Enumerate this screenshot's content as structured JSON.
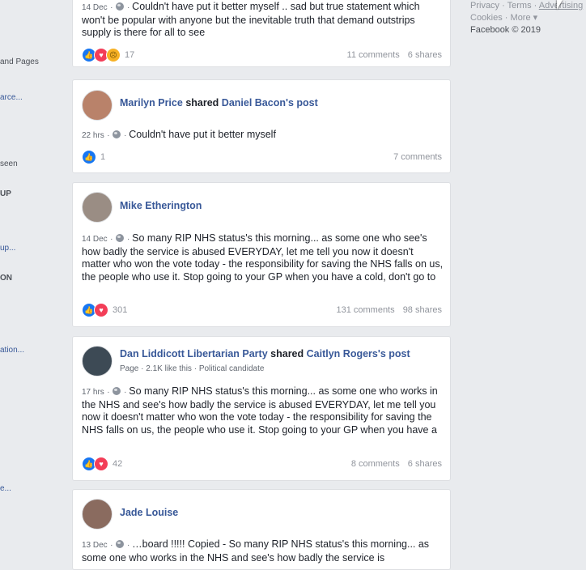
{
  "sidebar": {
    "items": [
      {
        "label": "and Pages",
        "style": "plain"
      },
      {
        "label": "arce...",
        "style": "link"
      },
      {
        "label": "seen",
        "style": "plain"
      },
      {
        "label": "UP",
        "style": "bold"
      },
      {
        "label": "up...",
        "style": "link"
      },
      {
        "label": "ON",
        "style": "bold"
      },
      {
        "label": "ation...",
        "style": "link"
      },
      {
        "label": "e...",
        "style": "link"
      }
    ]
  },
  "footer": {
    "privacy": "Privacy",
    "terms": "Terms",
    "advertising": "Advertising",
    "cookies": "Cookies",
    "more": "More",
    "copyright": "Facebook © 2019"
  },
  "posts": [
    {
      "time": "14 Dec",
      "text": "Couldn't have put it better myself .. sad but true statement which won't be popular with anyone but the inevitable truth that demand outstrips supply is there for all to see",
      "reactions_count": "17",
      "comments": "11 comments",
      "shares": "6 shares"
    },
    {
      "author": "Marilyn Price",
      "verb": "shared",
      "target": "Daniel Bacon's post",
      "time": "22 hrs",
      "text": "Couldn't have put it better myself",
      "reactions_count": "1",
      "comments": "7 comments",
      "avatar_color": "#b9826a"
    },
    {
      "author": "Mike Etherington",
      "time": "14 Dec",
      "text": "So many RIP NHS status's this morning... as some one who see's how badly the service is abused EVERYDAY, let me tell you now it doesn't matter who won the vote today - the responsibility for saving the NHS falls on us, the people who use it. Stop going to your GP when you have a cold, don't go to A&E for back ache, if you are genuinely unwell…",
      "reactions_count": "301",
      "comments": "131 comments",
      "shares": "98 shares",
      "avatar_color": "#9a8d84"
    },
    {
      "author": "Dan Liddicott Libertarian Party",
      "verb": "shared",
      "target": "Caitlyn Rogers's post",
      "subline": "Page · 2.1K like this · Political candidate",
      "time": "17 hrs",
      "text": "So many RIP NHS status's this morning... as some one who works in the NHS and see's how badly the service is abused EVERYDAY, let me tell you now it doesn't matter who won the vote today - the responsibility for saving the NHS falls on us, the people who use it. Stop going to your GP when you have a cold, don't go to A&E for back ache, if you are genuinely…",
      "reactions_count": "42",
      "comments": "8 comments",
      "shares": "6 shares",
      "avatar_color": "#3d4a55"
    },
    {
      "author": "Jade Louise",
      "time": "13 Dec",
      "text": "…board !!!!! Copied - So many RIP NHS status's this morning... as some one who works in the NHS and see's how badly the service is",
      "avatar_color": "#8a6b5f"
    }
  ],
  "colors": {
    "link": "#385898",
    "like": "#1877f2",
    "love": "#f33e58",
    "sad": "#f7b125"
  }
}
